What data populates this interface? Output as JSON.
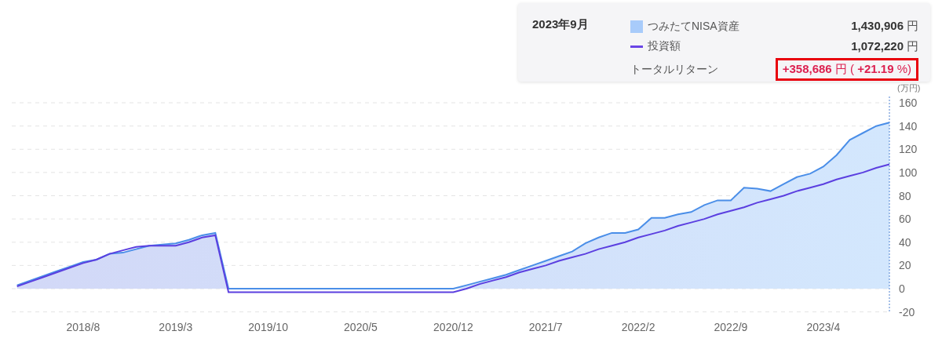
{
  "tooltip": {
    "date": "2023年9月",
    "rows": [
      {
        "kind": "swatch",
        "value": "1,430,906",
        "unit": "円",
        "color": "#a8cbfa"
      },
      {
        "kind": "line",
        "value": "1,072,220",
        "unit": "円",
        "color": "#6a45e6"
      }
    ],
    "total": {
      "label": "トータルリターン",
      "text": "**+358,686** 円 ( **+21.19** %)",
      "highlighted": true
    }
  },
  "chart_data": {
    "type": "area",
    "grid": true,
    "ylabel": "(万円)",
    "ylim": [
      -20,
      160
    ],
    "categories": [
      null,
      null,
      null,
      null,
      null,
      "2018/8",
      null,
      null,
      null,
      null,
      null,
      null,
      "2019/3",
      null,
      null,
      null,
      null,
      null,
      null,
      "2019/10",
      null,
      null,
      null,
      null,
      null,
      null,
      "2020/5",
      null,
      null,
      null,
      null,
      null,
      null,
      "2020/12",
      null,
      null,
      null,
      null,
      null,
      null,
      "2021/7",
      null,
      null,
      null,
      null,
      null,
      null,
      "2022/2",
      null,
      null,
      null,
      null,
      null,
      null,
      "2022/9",
      null,
      null,
      null,
      null,
      null,
      null,
      "2023/4",
      null,
      null,
      null,
      null,
      null
    ],
    "yticks": [
      -20,
      0,
      20,
      40,
      60,
      80,
      100,
      120,
      140,
      160
    ],
    "series": [
      {
        "name": "つみたてNISA資産",
        "type": "area",
        "color": "#4a8ee8",
        "values": [
          3,
          7,
          11,
          15,
          19,
          23,
          25,
          30,
          31,
          34,
          37,
          38,
          39,
          42,
          46,
          48,
          0,
          0,
          0,
          0,
          0,
          0,
          0,
          0,
          0,
          0,
          0,
          0,
          0,
          0,
          0,
          0,
          0,
          0,
          3,
          6,
          9,
          12,
          16,
          20,
          24,
          28,
          32,
          39,
          44,
          48,
          48,
          51,
          61,
          61,
          64,
          66,
          72,
          76,
          76,
          87,
          86,
          84,
          90,
          96,
          99,
          105,
          115,
          128,
          134,
          140,
          143
        ]
      },
      {
        "name": "投資額",
        "type": "line",
        "color": "#5b3fe0",
        "values": [
          2,
          6,
          10,
          14,
          18,
          22,
          25,
          30,
          33,
          36,
          37,
          37,
          37,
          40,
          44,
          46,
          -3,
          -3,
          -3,
          -3,
          -3,
          -3,
          -3,
          -3,
          -3,
          -3,
          -3,
          -3,
          -3,
          -3,
          -3,
          -3,
          -3,
          -3,
          0,
          4,
          7,
          10,
          14,
          17,
          20,
          24,
          27,
          30,
          34,
          37,
          40,
          44,
          47,
          50,
          54,
          57,
          60,
          64,
          67,
          70,
          74,
          77,
          80,
          84,
          87,
          90,
          94,
          97,
          100,
          104,
          107
        ]
      }
    ]
  }
}
